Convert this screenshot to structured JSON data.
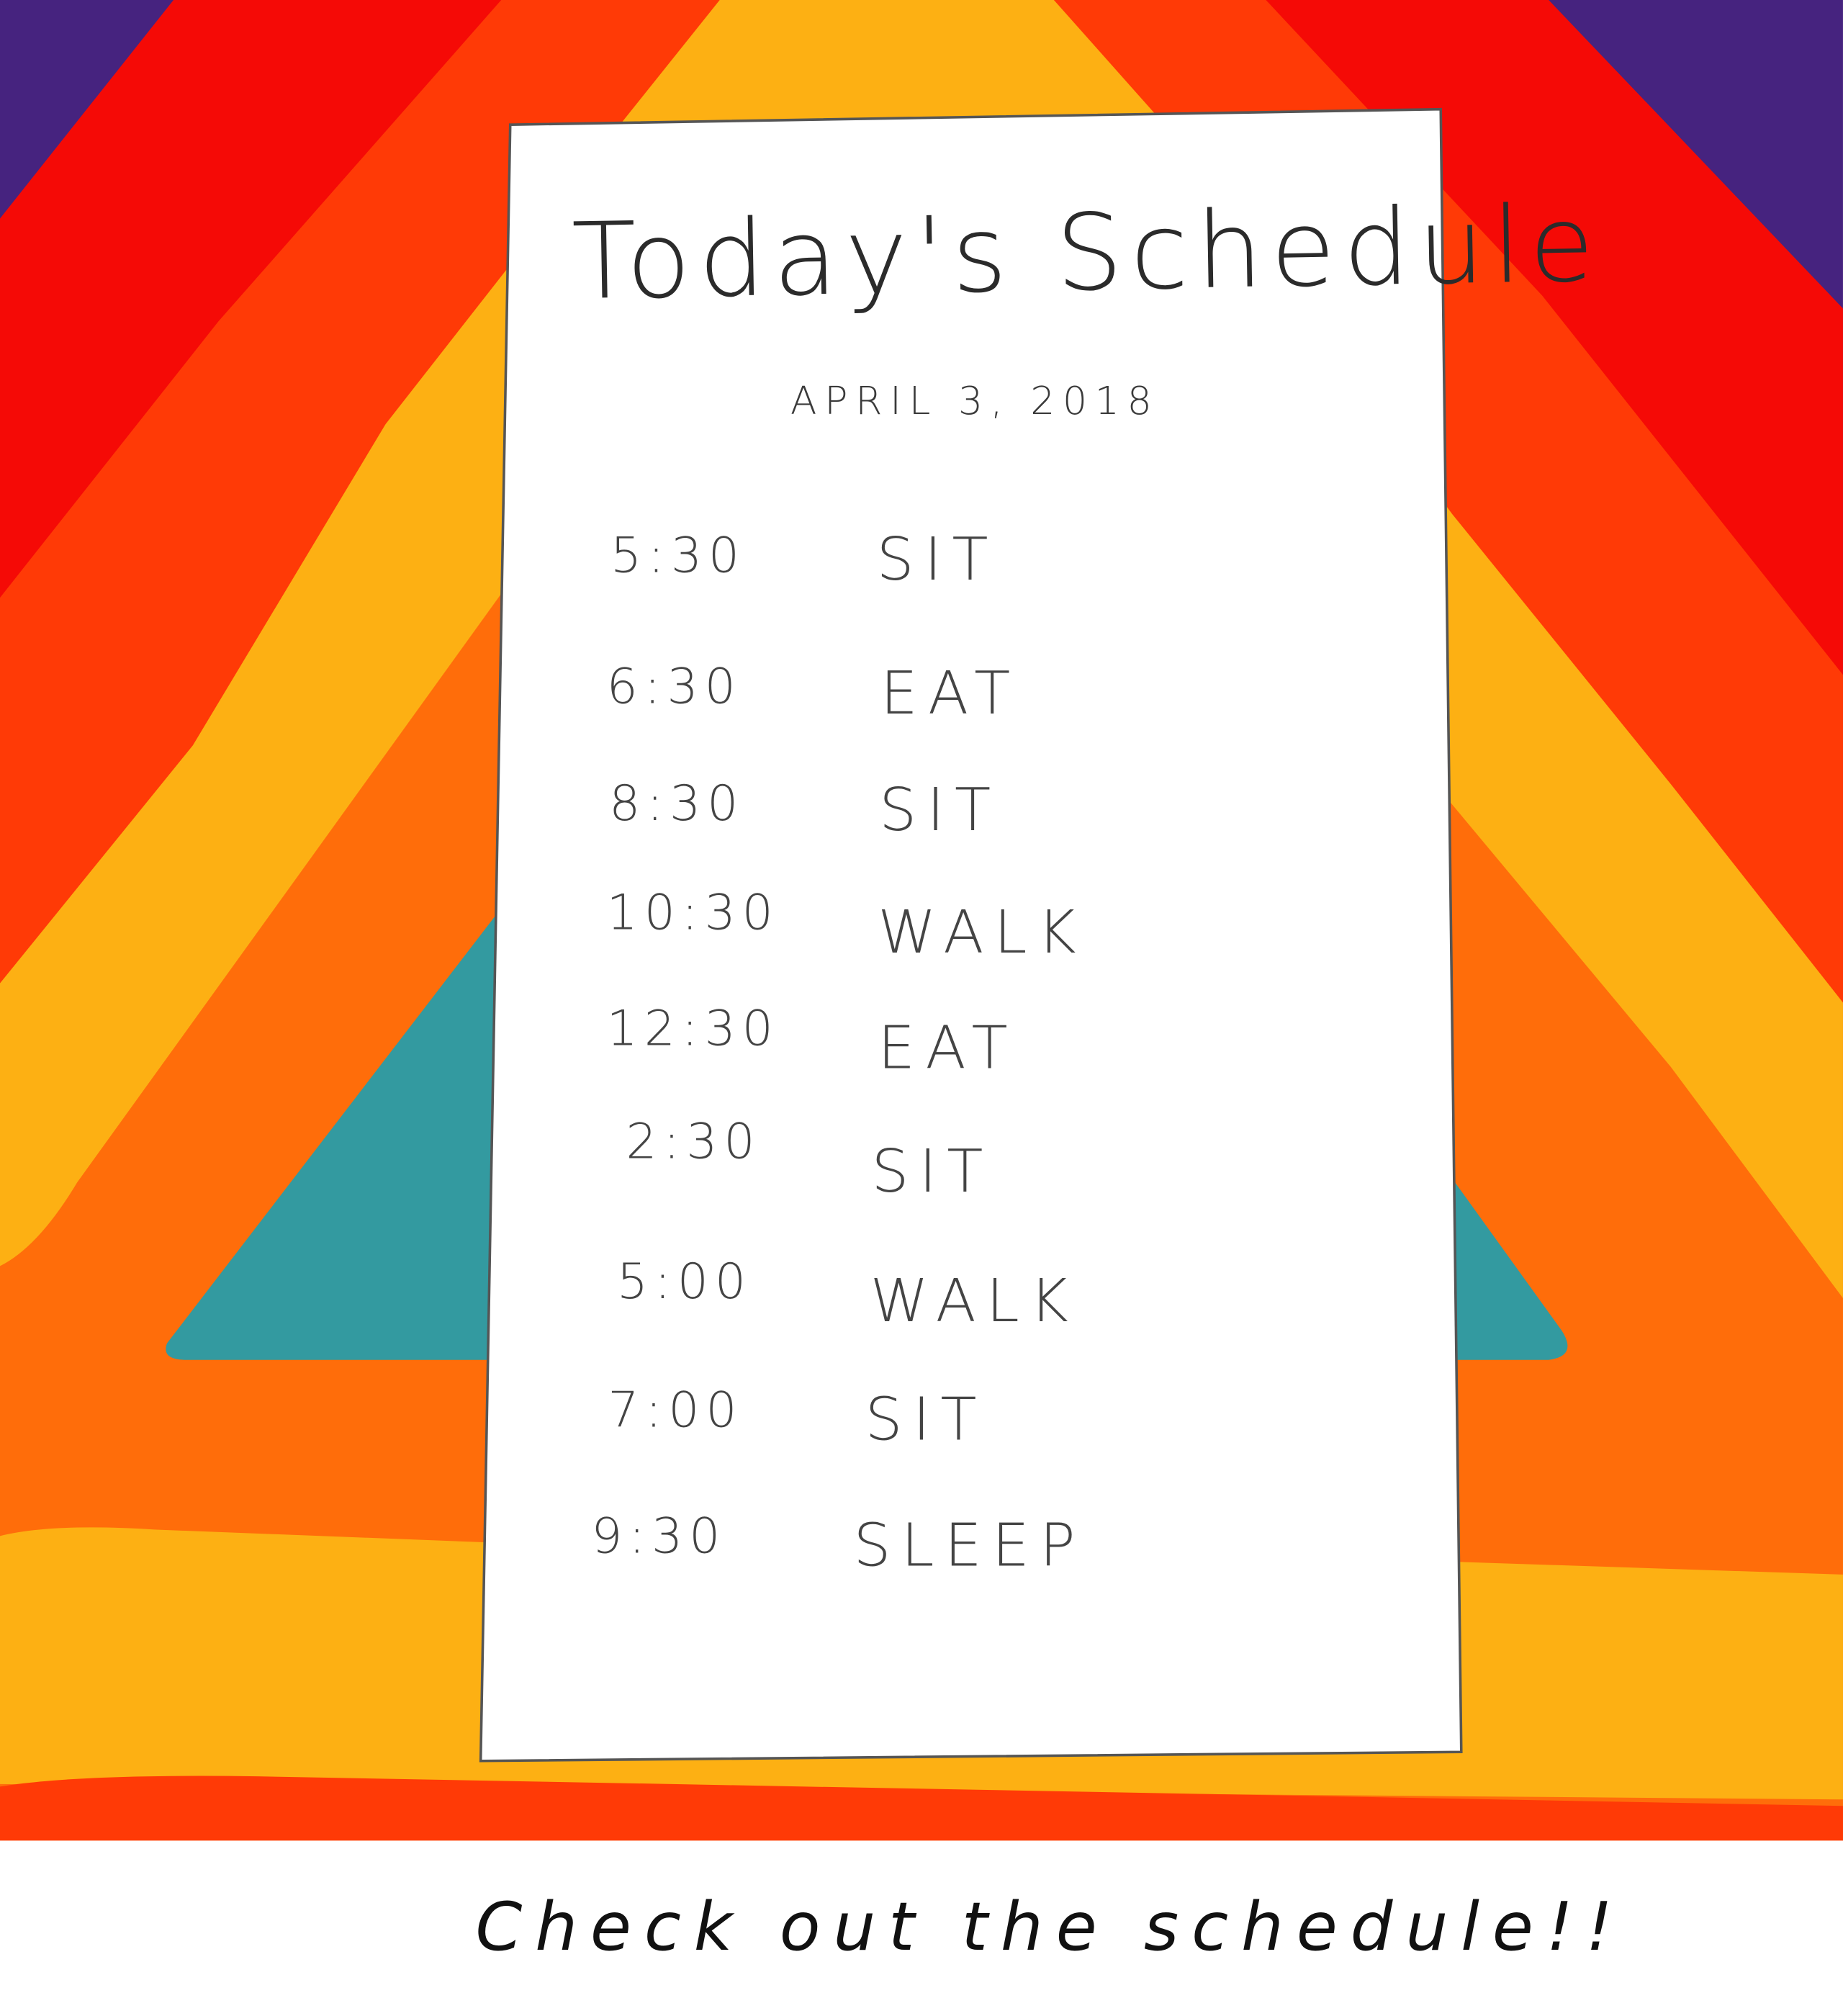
{
  "colors": {
    "purple": "#46237f",
    "red": "#f50a06",
    "orange_red": "#ff3a06",
    "yellow": "#fdb013",
    "orange": "#ff6d0a",
    "teal": "#339aa0",
    "paper": "#ffffff"
  },
  "schedule": {
    "title": "Today's Schedule",
    "date": "APRIL 3, 2018",
    "items": [
      {
        "time": "5:30",
        "activity": "SIT"
      },
      {
        "time": "6:30",
        "activity": "EAT"
      },
      {
        "time": "8:30",
        "activity": "SIT"
      },
      {
        "time": "10:30",
        "activity": "WALK"
      },
      {
        "time": "12:30",
        "activity": "EAT"
      },
      {
        "time": "2:30",
        "activity": "SIT"
      },
      {
        "time": "5:00",
        "activity": "WALK"
      },
      {
        "time": "7:00",
        "activity": "SIT"
      },
      {
        "time": "9:30",
        "activity": "SLEEP"
      }
    ]
  },
  "caption": "Check out the schedule!!"
}
